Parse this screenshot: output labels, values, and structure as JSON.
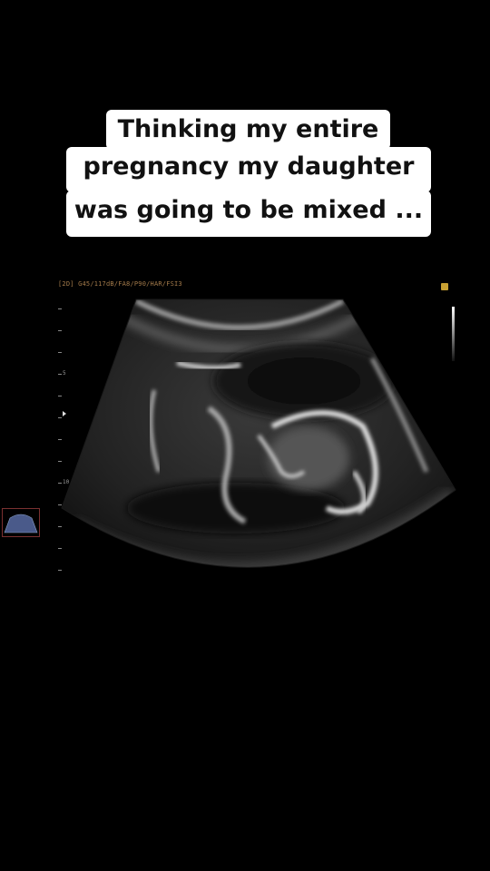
{
  "caption": {
    "lines": [
      "Thinking my entire",
      "pregnancy my daughter",
      "was going to be mixed ..."
    ]
  },
  "ultrasound": {
    "header_text": "[2D] G45/117dB/FA8/P90/HAR/FSI3",
    "depth_labels": [
      "5",
      "10"
    ],
    "image_subject": "ultrasound-scan",
    "colors": {
      "header_text": "#a37a4a",
      "marker": "#c8a032",
      "probe_outline": "#7a3030"
    }
  }
}
